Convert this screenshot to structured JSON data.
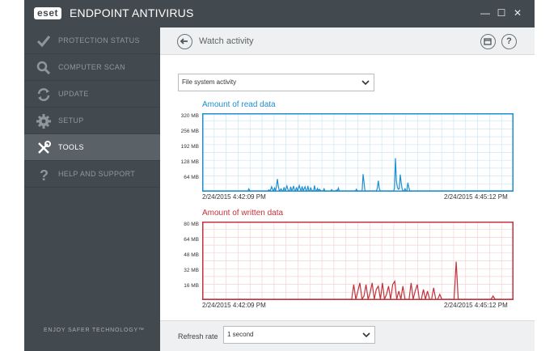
{
  "app": {
    "logo": "eset",
    "title": "ENDPOINT ANTIVIRUS"
  },
  "window_buttons": {
    "minimize": "—",
    "maximize": "☐",
    "close": "✕"
  },
  "sidebar": {
    "items": [
      {
        "label": "PROTECTION STATUS",
        "icon": "checkmark-icon",
        "active": false
      },
      {
        "label": "COMPUTER SCAN",
        "icon": "magnifier-icon",
        "active": false
      },
      {
        "label": "UPDATE",
        "icon": "refresh-icon",
        "active": false
      },
      {
        "label": "SETUP",
        "icon": "gear-icon",
        "active": false
      },
      {
        "label": "TOOLS",
        "icon": "tools-icon",
        "active": true
      },
      {
        "label": "HELP AND SUPPORT",
        "icon": "question-icon",
        "active": false
      }
    ],
    "tagline": "ENJOY SAFER TECHNOLOGY™"
  },
  "header": {
    "title": "Watch activity",
    "popout_icon": "window-icon",
    "help_label": "?"
  },
  "activity_select": {
    "value": "File system activity"
  },
  "read_chart": {
    "title": "Amount of read data",
    "color": "#1e8fce",
    "y_labels": [
      "320 MB",
      "256 MB",
      "192 MB",
      "128 MB",
      "64 MB"
    ],
    "start_time": "2/24/2015 4:42:09 PM",
    "end_time": "2/24/2015 4:45:12 PM"
  },
  "write_chart": {
    "title": "Amount of written data",
    "color": "#c2323b",
    "y_labels": [
      "80 MB",
      "64 MB",
      "48 MB",
      "32 MB",
      "16 MB"
    ],
    "start_time": "2/24/2015 4:42:09 PM",
    "end_time": "2/24/2015 4:45:12 PM"
  },
  "chart_data": [
    {
      "type": "line",
      "title": "Amount of read data",
      "ylim": [
        0,
        384
      ],
      "yunit": "MB",
      "x_range": [
        "2/24/2015 4:42:09 PM",
        "2/24/2015 4:45:12 PM"
      ],
      "grid": true,
      "series": [
        {
          "values": [
            0,
            0,
            0,
            0,
            0,
            0,
            0,
            0,
            0,
            0,
            0,
            0,
            0,
            0,
            0,
            0,
            0,
            0,
            0,
            0,
            0,
            0,
            0,
            0,
            0,
            0,
            0,
            0,
            0,
            0,
            0,
            0,
            0,
            0,
            0,
            0,
            0,
            0,
            0,
            0,
            0,
            0,
            0,
            0,
            0,
            0,
            0,
            0,
            0,
            10,
            0,
            0,
            0,
            0,
            0,
            0,
            0,
            0,
            0,
            0,
            0,
            0,
            0,
            0,
            0,
            0,
            0,
            0,
            0,
            0,
            5,
            0,
            8,
            20,
            6,
            0,
            14,
            0,
            20,
            58,
            22,
            0,
            4,
            10,
            0,
            0,
            18,
            0,
            10,
            24,
            8,
            0,
            0,
            20,
            0,
            10,
            24,
            0,
            0,
            18,
            0,
            12,
            26,
            8,
            0,
            22,
            0,
            10,
            20,
            0,
            0,
            24,
            0,
            0,
            14,
            4,
            0,
            0,
            26,
            0,
            0,
            12,
            0,
            8,
            4,
            0,
            0,
            0,
            10,
            0,
            0,
            0,
            0,
            0,
            0,
            0,
            6,
            0,
            0,
            0,
            0,
            4,
            0,
            14,
            0,
            0,
            0,
            0,
            0,
            0,
            0,
            0,
            0,
            0,
            0,
            0,
            0,
            0,
            0,
            0,
            0,
            0,
            8,
            0,
            0,
            0,
            0,
            0,
            0,
            82,
            40,
            0,
            0,
            0,
            0,
            0,
            0,
            0,
            0,
            0,
            0,
            0,
            0,
            0,
            14,
            50,
            12,
            0,
            0,
            0,
            0,
            0,
            0,
            0,
            0,
            0,
            0,
            0,
            0,
            0,
            0,
            0,
            12,
            160,
            48,
            18,
            8,
            10,
            80,
            40,
            10,
            0,
            0,
            10,
            0,
            0,
            40,
            18,
            0,
            0,
            0,
            0,
            0,
            0,
            0,
            0,
            0,
            0,
            0,
            0,
            0,
            0,
            0,
            0,
            0,
            0,
            0,
            0,
            0,
            0,
            0,
            0,
            0,
            0,
            0,
            0,
            0,
            0,
            0,
            0,
            0,
            0,
            0,
            0,
            0,
            0,
            0,
            0,
            0,
            0,
            0,
            0,
            0,
            0,
            0,
            0,
            0,
            0,
            0,
            0,
            0,
            0,
            0,
            0,
            0,
            0,
            0,
            0,
            0,
            0,
            0,
            0,
            0,
            0,
            0,
            0,
            0,
            0,
            0,
            0,
            0,
            0,
            0,
            0,
            0,
            0,
            0,
            0,
            0,
            0,
            0,
            0,
            0,
            0,
            0,
            0,
            0,
            0,
            0,
            0,
            0,
            0,
            0,
            0,
            0,
            0,
            0,
            0,
            0,
            0,
            0,
            0,
            0,
            0,
            0,
            0,
            0,
            0
          ]
        }
      ]
    },
    {
      "type": "line",
      "title": "Amount of written data",
      "ylim": [
        0,
        96
      ],
      "yunit": "MB",
      "x_range": [
        "2/24/2015 4:42:09 PM",
        "2/24/2015 4:45:12 PM"
      ],
      "grid": true,
      "series": [
        {
          "values": [
            0,
            0,
            0,
            0,
            0,
            0,
            0,
            0,
            0,
            0,
            0,
            0,
            0,
            0,
            0,
            0,
            0,
            0,
            0,
            0,
            0,
            0,
            0,
            0,
            0,
            0,
            0,
            0,
            0,
            0,
            0,
            0,
            0,
            0,
            0,
            0,
            0,
            0,
            0,
            0,
            0,
            0,
            0,
            0,
            0,
            0,
            0,
            0,
            0,
            0,
            0,
            0,
            0,
            0,
            0,
            0,
            0,
            0,
            0,
            0,
            0,
            0,
            0,
            0,
            0,
            0,
            0,
            0,
            0,
            0,
            0,
            0,
            0,
            0,
            18,
            0,
            10,
            20,
            0,
            4,
            18,
            0,
            8,
            20,
            0,
            12,
            16,
            0,
            20,
            0,
            6,
            16,
            0,
            18,
            22,
            0,
            10,
            0,
            16,
            0,
            0,
            0,
            20,
            0,
            10,
            18,
            0,
            0,
            12,
            0,
            10,
            0,
            0,
            14,
            0,
            0,
            6,
            0,
            0,
            0,
            0,
            0,
            0,
            0,
            46,
            0,
            0,
            0,
            0,
            0,
            0,
            0,
            0,
            0,
            0,
            0,
            0,
            0,
            0,
            0,
            0,
            0,
            4,
            0,
            0,
            0,
            0,
            0,
            0,
            0,
            0,
            0,
            0
          ]
        }
      ]
    }
  ],
  "refresh": {
    "label": "Refresh rate",
    "value": "1 second"
  }
}
